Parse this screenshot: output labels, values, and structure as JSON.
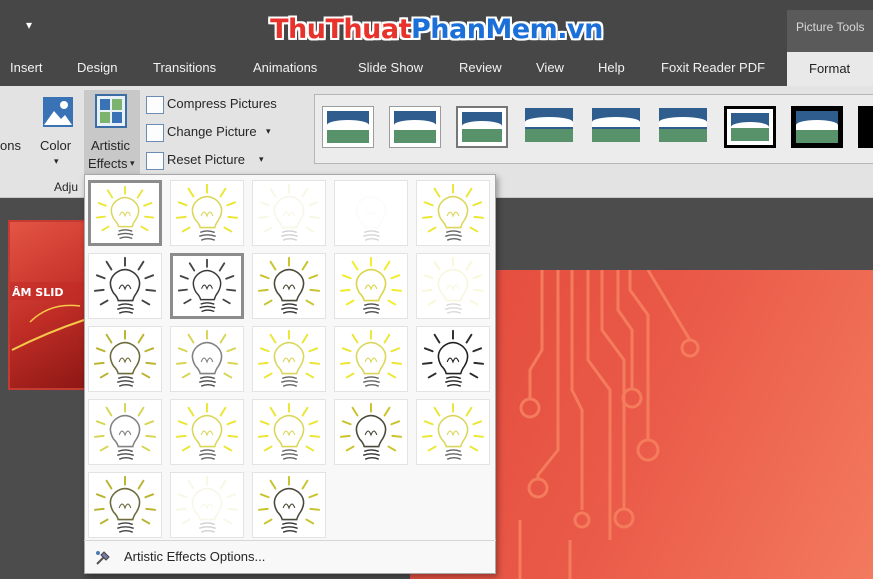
{
  "titlebar": {
    "qat_arrow": "▾",
    "watermark_parts": [
      "Thu",
      "Thuat",
      "Phan",
      "Mem",
      ".vn"
    ],
    "context_tab_group": "Picture Tools"
  },
  "tabs": [
    "Insert",
    "Design",
    "Transitions",
    "Animations",
    "Slide Show",
    "Review",
    "View",
    "Help",
    "Foxit Reader PDF"
  ],
  "active_tab": "Format",
  "ribbon": {
    "partial_corrections": "ons",
    "color": "Color",
    "color_arrow": "▾",
    "artistic_effects_line1": "Artistic",
    "artistic_effects_line2": "Effects",
    "compress_pictures": "Compress Pictures",
    "change_picture": "Change Picture",
    "reset_picture": "Reset Picture",
    "group_label_partial": "Adju"
  },
  "artistic_effects_menu": {
    "cells": [
      {
        "style": "yellow-soft"
      },
      {
        "style": "yellow-soft"
      },
      {
        "style": "faint"
      },
      {
        "style": "blank"
      },
      {
        "style": "yellow-soft"
      },
      {
        "style": "dark-sketch"
      },
      {
        "style": "dark-sketch"
      },
      {
        "style": "dark-yellow"
      },
      {
        "style": "yellow-bright"
      },
      {
        "style": "blur"
      },
      {
        "style": "olive"
      },
      {
        "style": "gray-yellow"
      },
      {
        "style": "yellow-soft"
      },
      {
        "style": "yellow-soft"
      },
      {
        "style": "dark-bold"
      },
      {
        "style": "gray-yellow"
      },
      {
        "style": "yellow-soft"
      },
      {
        "style": "yellow-soft"
      },
      {
        "style": "dark-yellow"
      },
      {
        "style": "yellow-soft"
      },
      {
        "style": "olive"
      },
      {
        "style": "faint"
      },
      {
        "style": "dark-yellow"
      }
    ],
    "selected_indices": [
      0,
      6
    ],
    "options_label": "Artistic Effects Options..."
  },
  "colors": {
    "title_bg": "#474747",
    "ribbon_bg": "#e3e3e3",
    "slide_red": "#e24a3c",
    "circuit": "#f47c5c",
    "sun_yellow": "#e8e219"
  }
}
